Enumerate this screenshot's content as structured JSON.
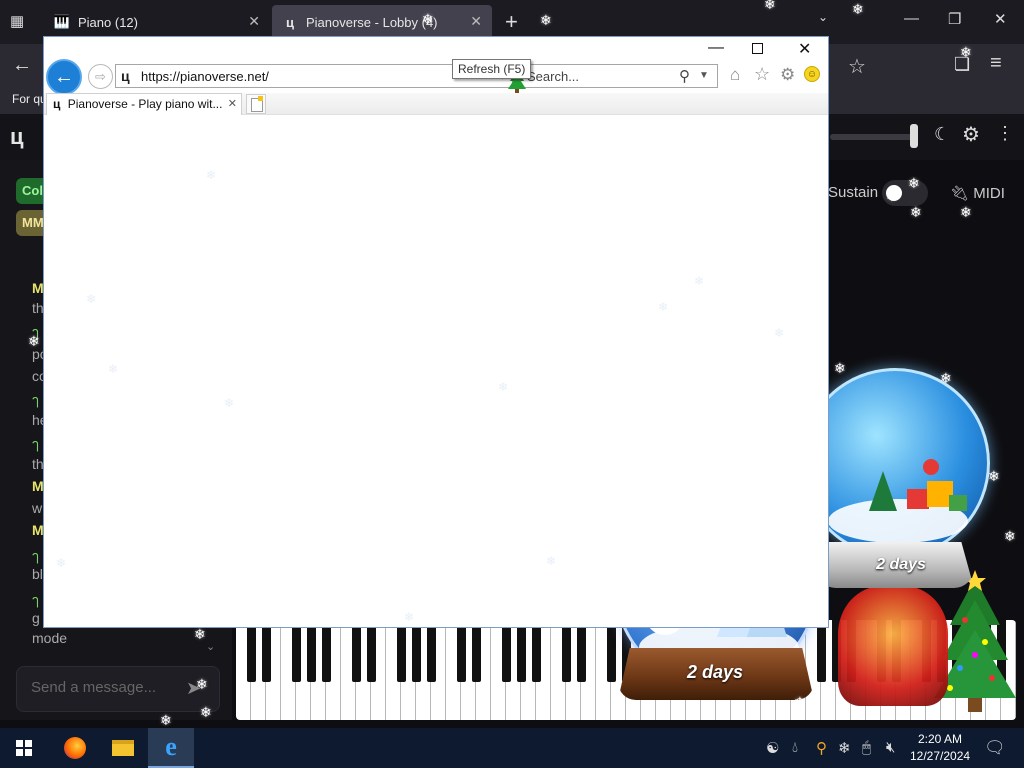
{
  "outer_browser": {
    "tabs": [
      {
        "title": "Piano (12)",
        "icon": "piano-icon"
      },
      {
        "title": "Pianoverse - Lobby (4)",
        "icon": "pianoverse-logo-icon",
        "active": true
      }
    ],
    "notice_text": "For qu"
  },
  "pianoverse": {
    "logo": "ц",
    "badges": [
      "Col",
      "MM"
    ],
    "chat_fragments": [
      {
        "text": "M",
        "style": "bold"
      },
      {
        "text": "th",
        "style": "plain"
      },
      {
        "text": "ๅ",
        "style": "green"
      },
      {
        "text": "po",
        "style": "plain"
      },
      {
        "text": "co",
        "style": "plain"
      },
      {
        "text": "ๅ",
        "style": "green"
      },
      {
        "text": "he",
        "style": "plain"
      },
      {
        "text": "ๅ",
        "style": "green"
      },
      {
        "text": "th",
        "style": "plain"
      },
      {
        "text": "M",
        "style": "bold"
      },
      {
        "text": "w",
        "style": "plain"
      },
      {
        "text": "M",
        "style": "bold"
      },
      {
        "text": "ๅ",
        "style": "green"
      },
      {
        "text": "bl",
        "style": "plain"
      },
      {
        "text": "ๅ",
        "style": "green"
      },
      {
        "text": "g",
        "style": "plain"
      },
      {
        "text": "mode",
        "style": "plain"
      }
    ],
    "chat_placeholder": "Send a message...",
    "sustain_label": "Sustain",
    "midi_label": "MIDI"
  },
  "ie": {
    "address": "https://pianoverse.net/",
    "search_placeholder": "Search...",
    "tab_title": "Pianoverse - Play piano wit...",
    "tooltip": "Refresh (F5)",
    "home_icon": "home-icon",
    "favorites_icon": "star-icon",
    "tools_icon": "gear-icon"
  },
  "decorations": {
    "globe_left_label": "2 days",
    "globe_right_label": "2 days"
  },
  "taskbar": {
    "apps": [
      "firefox-icon",
      "file-explorer-icon",
      "internet-explorer-icon"
    ],
    "time": "2:20 AM",
    "date": "12/27/2024"
  },
  "colors": {
    "accent": "#1e7fd6",
    "taskbar": "#0d1a30",
    "page_bg": "#0e0e12"
  }
}
